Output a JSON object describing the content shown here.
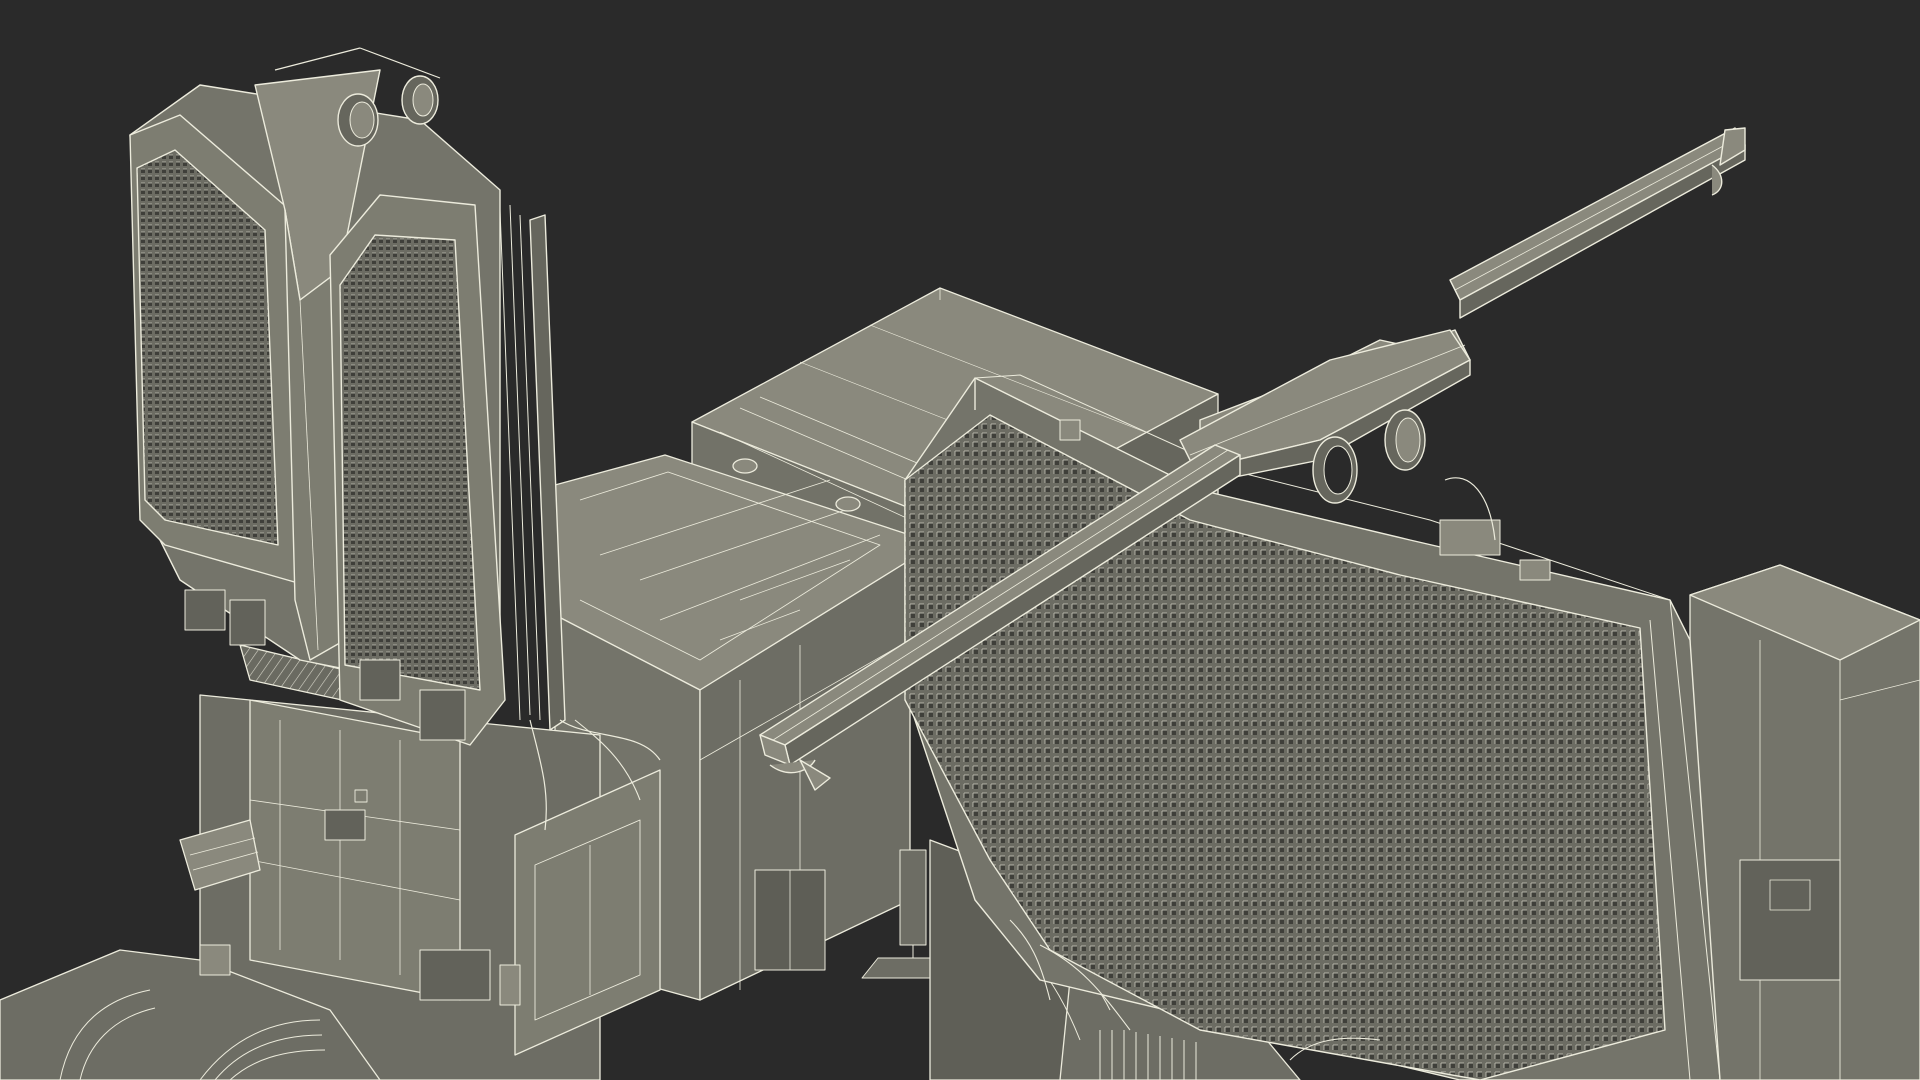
{
  "scene": {
    "background_color": "#2a2a2a",
    "body_color": "#7d7d71",
    "body_dark_color": "#62625a",
    "body_light_color": "#908f83",
    "wire_color": "#ecebdc",
    "grid_color": "#4f4f49"
  }
}
